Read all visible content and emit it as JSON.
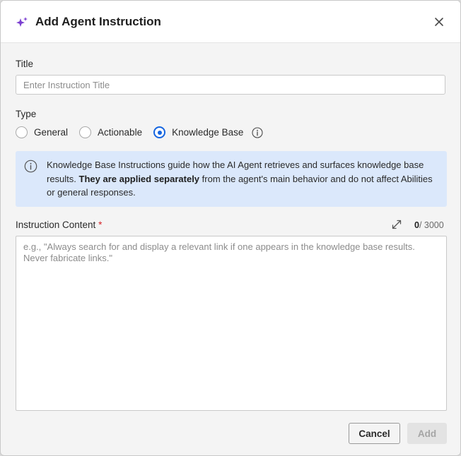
{
  "dialog": {
    "title": "Add Agent Instruction",
    "icons": {
      "title": "sparkle-icon",
      "close": "close-icon"
    }
  },
  "title_field": {
    "label": "Title",
    "value": "",
    "placeholder": "Enter Instruction Title"
  },
  "type_field": {
    "label": "Type",
    "options": [
      {
        "label": "General",
        "checked": false
      },
      {
        "label": "Actionable",
        "checked": false
      },
      {
        "label": "Knowledge Base",
        "checked": true
      }
    ],
    "selected": "Knowledge Base",
    "info_icon": "info-icon"
  },
  "banner": {
    "icon": "info-icon",
    "text_before": "Knowledge Base Instructions guide how the AI Agent retrieves and surfaces knowledge base results. ",
    "text_bold": "They are applied separately",
    "text_after": " from the agent's main behavior and do not affect Abilities or general responses."
  },
  "content_field": {
    "label": "Instruction Content",
    "required_mark": "*",
    "expand_icon": "expand-icon",
    "count_current": "0",
    "count_max": "/ 3000",
    "value": "",
    "placeholder": "e.g., \"Always search for and display a relevant link if one appears in the knowledge base results. Never fabricate links.\""
  },
  "footer": {
    "cancel_label": "Cancel",
    "add_label": "Add",
    "add_disabled": true
  },
  "colors": {
    "accent": "#1565e0",
    "sparkle": "#7b3fd0",
    "banner_bg": "#dbe8fb",
    "required": "#d4242a",
    "dialog_bg": "#f4f4f4"
  }
}
